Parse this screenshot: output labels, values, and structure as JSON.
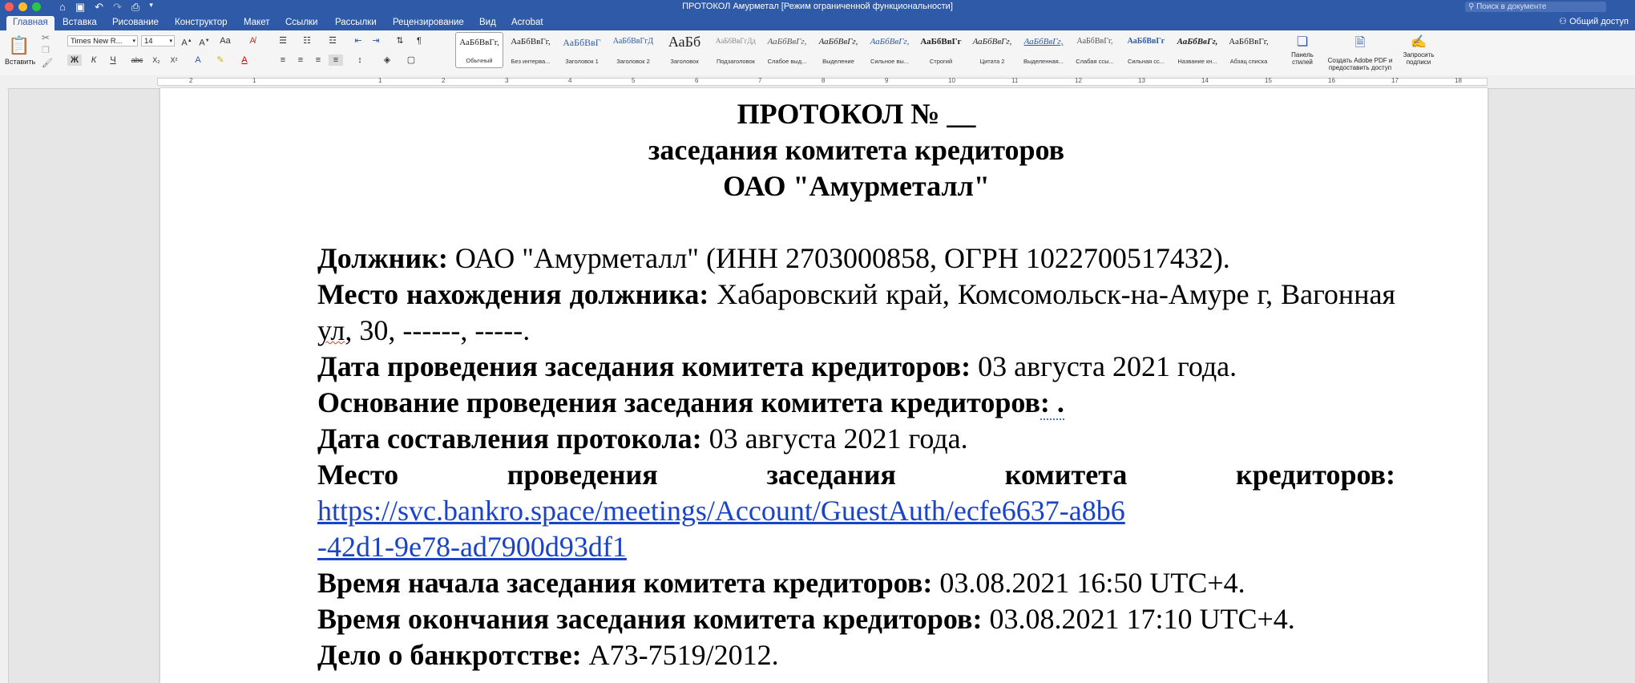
{
  "window": {
    "title": "ПРОТОКОЛ Амурметал [Режим ограниченной функциональности]",
    "search_placeholder": "Поиск в документе",
    "share_label": "Общий доступ"
  },
  "tabs": [
    "Главная",
    "Вставка",
    "Рисование",
    "Конструктор",
    "Макет",
    "Ссылки",
    "Рассылки",
    "Рецензирование",
    "Вид",
    "Acrobat"
  ],
  "ribbon": {
    "paste_label": "Вставить",
    "font_name": "Times New R...",
    "font_size": "14",
    "bold": "Ж",
    "italic": "К",
    "underline": "Ч",
    "strike": "abc",
    "subscript": "X₂",
    "superscript": "X²",
    "styles": [
      {
        "sample": "АаБбВвГг,",
        "name": "Обычный"
      },
      {
        "sample": "АаБбВвГг,",
        "name": "Без интерва..."
      },
      {
        "sample": "АаБбВвГ",
        "name": "Заголовок 1"
      },
      {
        "sample": "АаБбВвГгД",
        "name": "Заголовок 2"
      },
      {
        "sample": "АаБб",
        "name": "Заголовок"
      },
      {
        "sample": "АаБбВвГгДд",
        "name": "Подзаголовок"
      },
      {
        "sample": "АаБбВвГг,",
        "name": "Слабое выд..."
      },
      {
        "sample": "АаБбВвГг,",
        "name": "Выделение"
      },
      {
        "sample": "АаБбВвГг,",
        "name": "Сильное вы..."
      },
      {
        "sample": "АаБбВвГг",
        "name": "Строгий"
      },
      {
        "sample": "АаБбВвГг,",
        "name": "Цитата 2"
      },
      {
        "sample": "АаБбВвГг,",
        "name": "Выделенная..."
      },
      {
        "sample": "АаБбВвГг,",
        "name": "Слабая ссы..."
      },
      {
        "sample": "АаБбВвГг",
        "name": "Сильная сс..."
      },
      {
        "sample": "АаБбВвГг,",
        "name": "Название кн..."
      },
      {
        "sample": "АаБбВвГг,",
        "name": "Абзац списка"
      }
    ],
    "styles_pane_label": "Панель стилей",
    "adobe_label_1": "Создать Adobe PDF и",
    "adobe_label_2": "предоставить доступ",
    "sign_label_1": "Запросить",
    "sign_label_2": "подписи"
  },
  "ruler_numbers": [
    "2",
    "1",
    "1",
    "2",
    "3",
    "4",
    "5",
    "6",
    "7",
    "8",
    "9",
    "10",
    "11",
    "12",
    "13",
    "14",
    "15",
    "16",
    "17",
    "18"
  ],
  "document": {
    "title1": "ПРОТОКОЛ № __",
    "title2": "заседания комитета кредиторов",
    "title3": "ОАО \"Амурметалл\"",
    "debtor_label": "Должник:",
    "debtor_value": " ОАО \"Амурметалл\" (ИНН 2703000858, ОГРН 1022700517432).",
    "location_label": "Место нахождения должника:",
    "location_value_1": " Хабаровский край, Комсомольск-на-Амуре г, Вагонная ",
    "location_value_ul": "ул",
    "location_value_2": ", 30, ------, -----.",
    "meeting_date_label": "Дата проведения заседания комитета кредиторов:",
    "meeting_date_value": " 03 августа 2021 года.",
    "basis_label": "Основание проведения заседания комитета кредиторов",
    "basis_colon": ": .",
    "protocol_date_label": "Дата составления протокола:",
    "protocol_date_value": " 03 августа 2021 года.",
    "venue_label": "Место проведения заседания комитета кредиторов:",
    "venue_link": "https://svc.bankro.space/meetings/Account/GuestAuth/ecfe6637-a8b6-42d1-9e78-ad7900d93df1",
    "start_label": "Время начала заседания комитета кредиторов:",
    "start_value": " 03.08.2021 16:50 UTC+4.",
    "end_label": "Время окончания заседания комитета кредиторов:",
    "end_value": " 03.08.2021 17:10 UTC+4.",
    "case_label": "Дело о банкротстве:",
    "case_value": " А73-7519/2012."
  }
}
